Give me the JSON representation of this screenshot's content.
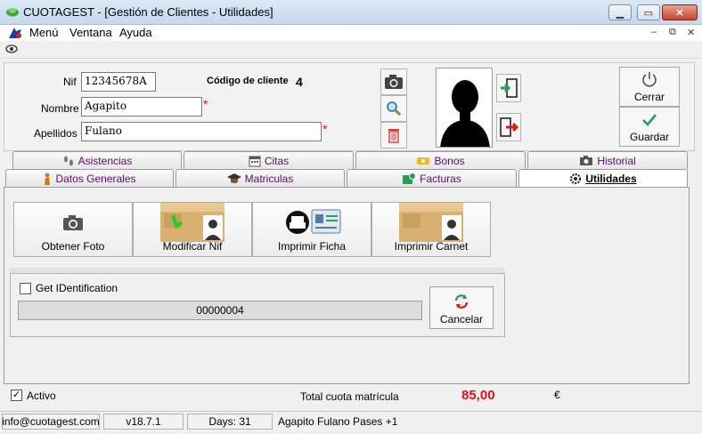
{
  "window": {
    "title": "CUOTAGEST - [Gestión de Clientes - Utilidades]"
  },
  "menu": {
    "items": [
      "Menú",
      "Ventana",
      "Ayuda"
    ]
  },
  "form": {
    "nif_label": "Nif",
    "nif_value": "12345678A",
    "nombre_label": "Nombre",
    "nombre_value": "Agapito",
    "apellidos_label": "Apellidos",
    "apellidos_value": "Fulano",
    "codigo_label": "Código de cliente",
    "codigo_value": "4",
    "required_mark": "*"
  },
  "actions": {
    "close_label": "Cerrar",
    "save_label": "Guardar"
  },
  "tabs": {
    "row1": [
      "Asistencias",
      "Citas",
      "Bonos",
      "Historial"
    ],
    "row2": [
      "Datos Generales",
      "Matriculas",
      "Facturas",
      "Utilidades"
    ],
    "active": "Utilidades"
  },
  "utilities": {
    "buttons": [
      "Obtener Foto",
      "Modificar Nif",
      "Imprimir Ficha",
      "Imprimir Carnet"
    ],
    "get_id_label": "Get IDentification",
    "id_value": "00000004",
    "cancel_label": "Cancelar"
  },
  "footer": {
    "activo_label": "Activo",
    "total_label": "Total cuota matrícula",
    "total_value": "85,00",
    "currency": "€"
  },
  "status": {
    "email": "info@cuotagest.com",
    "version": "v18.7.1",
    "days": "Days: 31",
    "user_info": "Agapito Fulano Pases +1"
  },
  "colors": {
    "required": "#e01010",
    "tab_text": "#5a0a6a",
    "total": "#e01010",
    "save_check": "#2e9a5a"
  }
}
